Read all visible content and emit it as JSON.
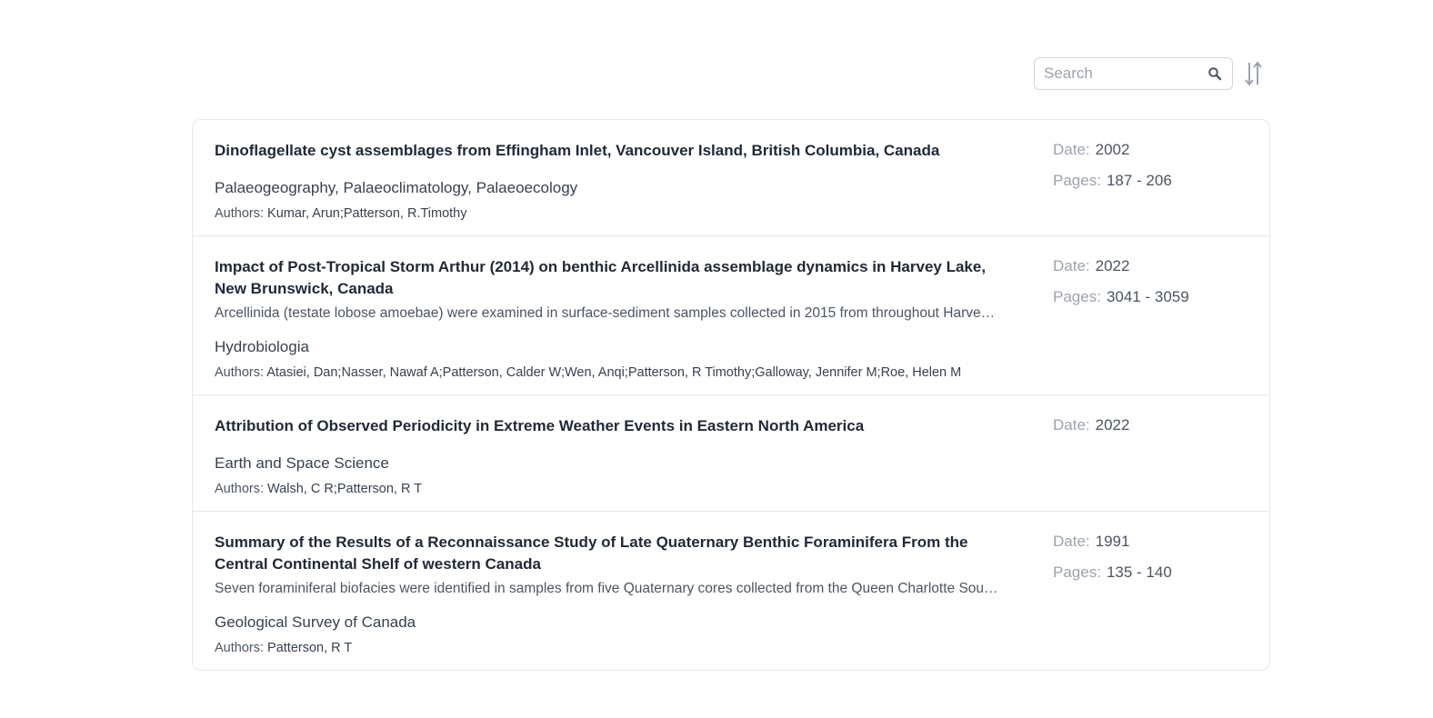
{
  "search": {
    "placeholder": "Search"
  },
  "labels": {
    "date": "Date:",
    "pages": "Pages:",
    "authors": "Authors:"
  },
  "items": [
    {
      "title": "Dinoflagellate cyst assemblages from Effingham Inlet, Vancouver Island, British Columbia, Canada",
      "abstract": "",
      "journal": "Palaeogeography, Palaeoclimatology, Palaeoecology",
      "authors": "Kumar, Arun;Patterson, R.Timothy",
      "date": "2002",
      "pages": "187 - 206"
    },
    {
      "title": "Impact of Post-Tropical Storm Arthur (2014) on benthic Arcellinida assemblage dynamics in Harvey Lake, New Brunswick, Canada",
      "abstract": "Arcellinida (testate lobose amoebae) were examined in surface-sediment samples collected in 2015 from throughout Harvey Lake, New Brunswick, Canada",
      "journal": "Hydrobiologia",
      "authors": "Atasiei, Dan;Nasser, Nawaf A;Patterson, Calder W;Wen, Anqi;Patterson, R Timothy;Galloway, Jennifer M;Roe, Helen M",
      "date": "2022",
      "pages": "3041 - 3059"
    },
    {
      "title": "Attribution of Observed Periodicity in Extreme Weather Events in Eastern North America",
      "abstract": "",
      "journal": "Earth and Space Science",
      "authors": "Walsh, C R;Patterson, R T",
      "date": "2022",
      "pages": ""
    },
    {
      "title": "Summary of the Results of a Reconnaissance Study of Late Quaternary Benthic Foraminifera From the Central Continental Shelf of western Canada",
      "abstract": "Seven foraminiferal biofacies were identified in samples from five Quaternary cores collected from the Queen Charlotte Sound",
      "journal": "Geological Survey of Canada",
      "authors": "Patterson, R T",
      "date": "1991",
      "pages": "135 - 140"
    }
  ]
}
